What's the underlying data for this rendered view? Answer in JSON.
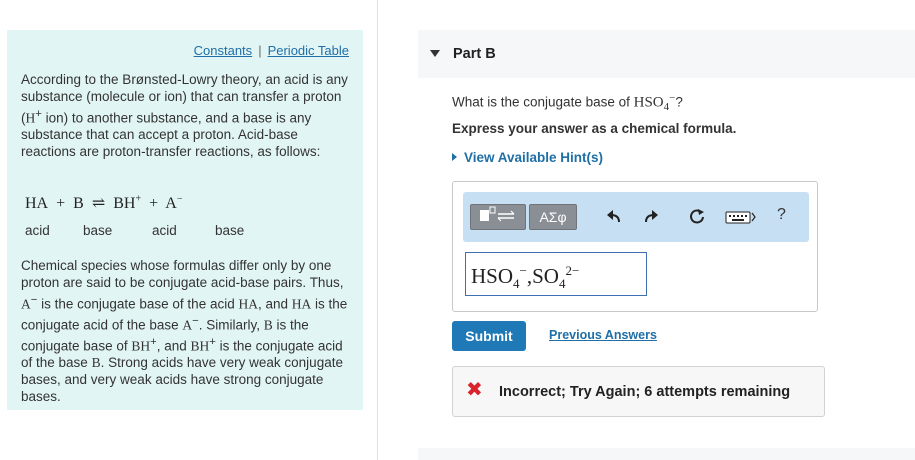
{
  "info": {
    "constants_link": "Constants",
    "separator": "|",
    "periodic_table_link": "Periodic Table",
    "para1": {
      "t1": "According to the Brønsted-Lowry theory, an acid is any substance (molecule or ion) that can transfer a proton (",
      "h": "H",
      "plus": "+",
      "t2": " ion) to another substance, and a base is any substance that can accept a proton. Acid-base reactions are proton-transfer reactions, as follows:"
    },
    "equation": {
      "ha": "HA",
      "plus1": "+",
      "b": "B",
      "arrow": "⇌",
      "bh": "BH",
      "bh_charge": "+",
      "plus2": "+",
      "a": "A",
      "a_charge": "−"
    },
    "eq_labels": [
      "acid",
      "base",
      "acid",
      "base"
    ],
    "para2": {
      "t1": "Chemical species whose formulas differ only by one proton are said to be conjugate acid-base pairs. Thus, ",
      "a": "A",
      "a_charge": "−",
      "t2": " is the conjugate base of the acid ",
      "ha1": "HA",
      "t3": ", and ",
      "ha2": "HA",
      "t4": " is the conjugate acid of the base ",
      "a2": "A",
      "a2_charge": "−",
      "t5": ". Similarly, ",
      "b": "B",
      "t6": " is the conjugate base of ",
      "bh1": "BH",
      "bh1_charge": "+",
      "t7": ", and ",
      "bh2": "BH",
      "bh2_charge": "+",
      "t8": " is the conjugate acid of the base ",
      "b2": "B",
      "t9": ". Strong acids have very weak conjugate bases, and very weak acids have strong conjugate bases."
    }
  },
  "part": {
    "title": "Part B",
    "question_prefix": "What is the conjugate base of ",
    "question_formula": "HSO",
    "question_sub": "4",
    "question_charge": "−",
    "question_suffix": "?",
    "instruction": "Express your answer as a chemical formula.",
    "hint_link": "View Available Hint(s)"
  },
  "editor": {
    "greek_button": "ΑΣφ",
    "help_label": "?",
    "answer": {
      "f1": "HSO",
      "s1": "4",
      "c1": "−",
      "comma": ",",
      "f2": "SO",
      "s2": "4",
      "c2": "2−"
    }
  },
  "actions": {
    "submit": "Submit",
    "previous_answers": "Previous Answers"
  },
  "feedback": {
    "icon": "✖",
    "text": "Incorrect; Try Again; 6 attempts remaining",
    "color": "#d9232d"
  }
}
